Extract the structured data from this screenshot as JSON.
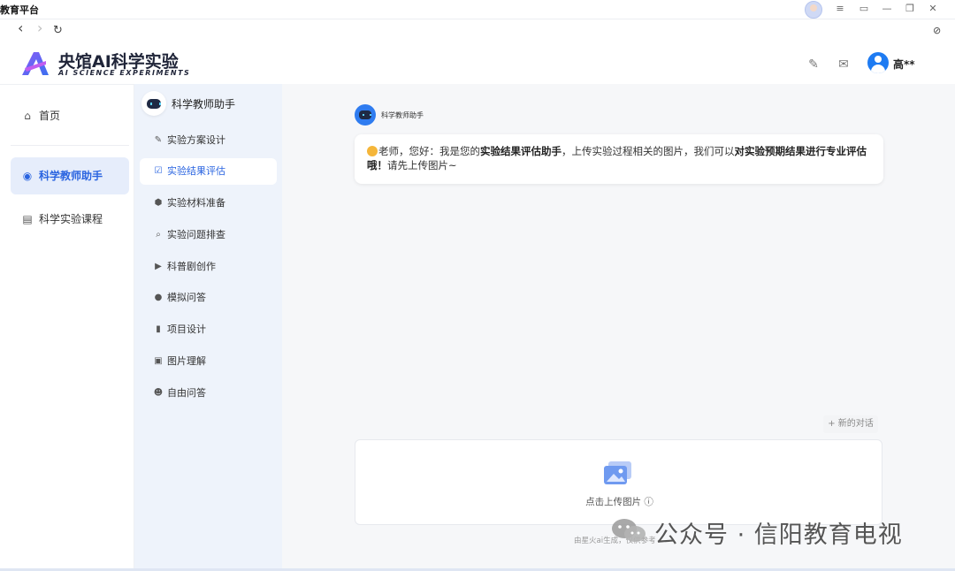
{
  "window": {
    "title": "教育平台",
    "controls": [
      "minimize-icon",
      "restore-icon",
      "close-icon"
    ]
  },
  "nav": {
    "back": "‹",
    "forward": "›",
    "refresh": "↻",
    "compass": "⊘"
  },
  "brand": {
    "title": "央馆AI科学实验",
    "subtitle": "AI SCIENCE EXPERIMENTS",
    "colors": {
      "primary": "#6a4bf0",
      "accent": "#2a64e0"
    }
  },
  "header": {
    "user_name": "高**",
    "icons": [
      "edit-note-icon",
      "mail-icon",
      "user-avatar-icon"
    ]
  },
  "sidebar": {
    "items": [
      {
        "label": "首页",
        "icon": "home-icon",
        "active": false
      },
      {
        "label": "科学教师助手",
        "icon": "robot-icon",
        "active": true
      },
      {
        "label": "科学实验课程",
        "icon": "monitor-icon",
        "active": false
      }
    ]
  },
  "subpanel": {
    "title": "科学教师助手",
    "items": [
      {
        "label": "实验方案设计",
        "icon": "pen-icon",
        "active": false
      },
      {
        "label": "实验结果评估",
        "icon": "evaluate-icon",
        "active": true
      },
      {
        "label": "实验材料准备",
        "icon": "cube-icon",
        "active": false
      },
      {
        "label": "实验问题排查",
        "icon": "search-icon",
        "active": false
      },
      {
        "label": "科普剧创作",
        "icon": "video-icon",
        "active": false
      },
      {
        "label": "模拟问答",
        "icon": "chat-icon",
        "active": false
      },
      {
        "label": "项目设计",
        "icon": "document-icon",
        "active": false
      },
      {
        "label": "图片理解",
        "icon": "image-icon",
        "active": false
      },
      {
        "label": "自由问答",
        "icon": "bubble-icon",
        "active": false
      }
    ]
  },
  "chat": {
    "bot_name": "科学教师助手",
    "message": {
      "p1": "老师，您好：我是您的",
      "b1": "实验结果评估助手",
      "p2": "，上传实验过程相关的图片，我们可以",
      "b2": "对实验预期结果进行专业评估哦！",
      "p3": "请先上传图片~"
    },
    "new_chat": "+ 新的对话",
    "upload_label": "点击上传图片 ⓘ",
    "footer_note": "由星火ai生成，仅供参考"
  },
  "watermark": {
    "text": "公众号 · 信阳教育电视"
  }
}
